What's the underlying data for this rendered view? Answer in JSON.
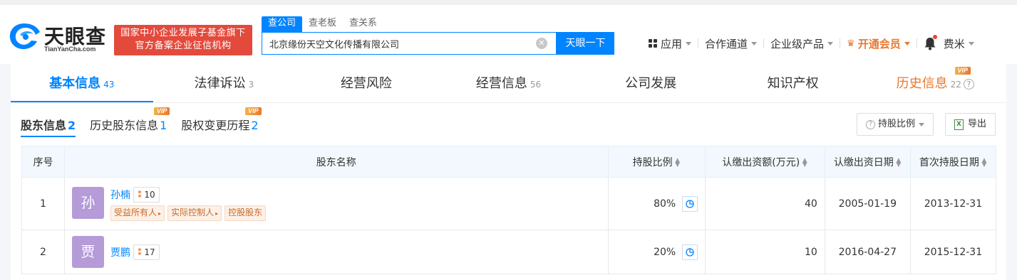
{
  "header": {
    "logo_text": "天眼查",
    "logo_sub": "TianYanCha.com",
    "banner_line1": "国家中小企业发展子基金旗下",
    "banner_line2": "官方备案企业征信机构",
    "search_tabs": [
      "查公司",
      "查老板",
      "查关系"
    ],
    "search_value": "北京缘份天空文化传播有限公司",
    "search_button": "天眼一下",
    "nav": {
      "apps": "应用",
      "channel": "合作通道",
      "enterprise": "企业级产品",
      "vip": "开通会员",
      "user": "费米"
    }
  },
  "company_tabs": [
    {
      "label": "基本信息",
      "count": "43"
    },
    {
      "label": "法律诉讼",
      "count": "3"
    },
    {
      "label": "经营风险",
      "count": ""
    },
    {
      "label": "经营信息",
      "count": "56"
    },
    {
      "label": "公司发展",
      "count": ""
    },
    {
      "label": "知识产权",
      "count": ""
    },
    {
      "label": "历史信息",
      "count": "22"
    }
  ],
  "vip_label": "VIP",
  "subtabs": [
    {
      "label": "股东信息",
      "count": "2"
    },
    {
      "label": "历史股东信息",
      "count": "1"
    },
    {
      "label": "股权变更历程",
      "count": "2"
    }
  ],
  "tools": {
    "ratio_filter": "持股比例",
    "export": "导出"
  },
  "table": {
    "headers": [
      "序号",
      "股东名称",
      "持股比例",
      "认缴出资额(万元)",
      "认缴出资日期",
      "首次持股日期"
    ],
    "rows": [
      {
        "index": "1",
        "avatar": "孙",
        "name": "孙楠",
        "relations": "10",
        "tags": [
          "受益所有人",
          "实际控制人",
          "控股股东"
        ],
        "ratio": "80%",
        "amount": "40",
        "subscribe_date": "2005-01-19",
        "first_date": "2013-12-31"
      },
      {
        "index": "2",
        "avatar": "贾",
        "name": "贾鹏",
        "relations": "17",
        "tags": [],
        "ratio": "20%",
        "amount": "10",
        "subscribe_date": "2016-04-27",
        "first_date": "2015-12-31"
      }
    ]
  }
}
